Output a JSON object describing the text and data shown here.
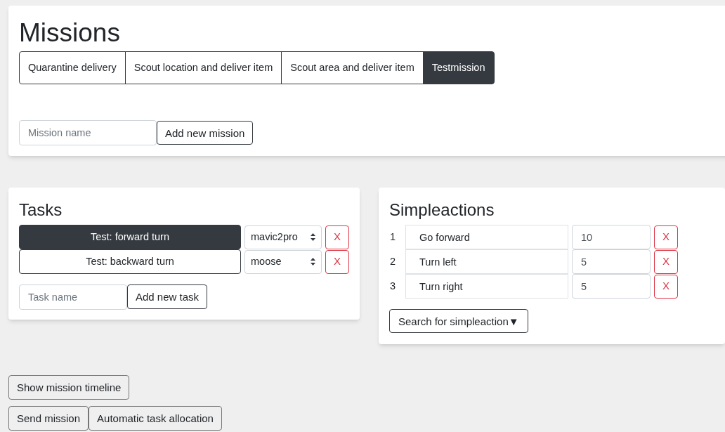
{
  "missions": {
    "title": "Missions",
    "tabs": [
      {
        "label": "Quarantine delivery",
        "selected": false
      },
      {
        "label": "Scout location and deliver item",
        "selected": false
      },
      {
        "label": "Scout area and deliver item",
        "selected": false
      },
      {
        "label": "Testmission",
        "selected": true
      }
    ],
    "name_field": {
      "placeholder": "Mission name"
    },
    "add_button": "Add new mission"
  },
  "tasks": {
    "title": "Tasks",
    "items": [
      {
        "label": "Test: forward turn",
        "selected": true,
        "drone": "mavic2pro",
        "delete": "X"
      },
      {
        "label": "Test: backward turn",
        "selected": false,
        "drone": "moose",
        "delete": "X"
      }
    ],
    "name_field": {
      "placeholder": "Task name"
    },
    "add_button": "Add new task"
  },
  "simpleactions": {
    "title": "Simpleactions",
    "items": [
      {
        "index": "1",
        "name": "Go forward",
        "value": "10",
        "delete": "X"
      },
      {
        "index": "2",
        "name": "Turn left",
        "value": "5",
        "delete": "X"
      },
      {
        "index": "3",
        "name": "Turn right",
        "value": "5",
        "delete": "X"
      }
    ],
    "search_button": "Search for simpleaction▼"
  },
  "buttons": {
    "timeline": "Show mission timeline",
    "send": "Send mission",
    "allocate": "Automatic task allocation"
  }
}
